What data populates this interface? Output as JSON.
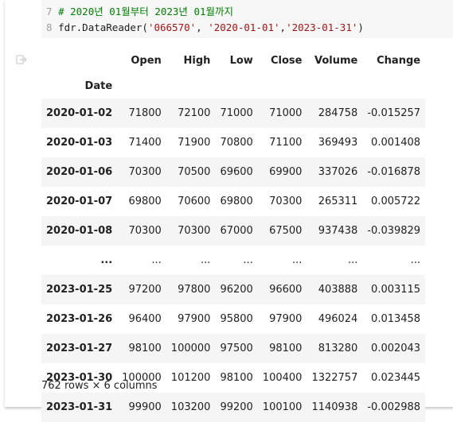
{
  "code": {
    "line7": {
      "number": "7",
      "text": "# 2020년 01월부터 2023년 01월까지"
    },
    "line8": {
      "number": "8",
      "prefix": "fdr.DataReader(",
      "arg1": "'066570'",
      "sep1": ", ",
      "arg2": "'2020-01-01'",
      "sep2": ",",
      "arg3": "'2023-01-31'",
      "suffix": ")"
    }
  },
  "output_icon": "output-redirect-icon",
  "dataframe": {
    "columns": [
      "Open",
      "High",
      "Low",
      "Close",
      "Volume",
      "Change"
    ],
    "index_name": "Date",
    "rows": [
      {
        "date": "2020-01-02",
        "open": "71800",
        "high": "72100",
        "low": "71000",
        "close": "71000",
        "volume": "284758",
        "change": "-0.015257"
      },
      {
        "date": "2020-01-03",
        "open": "71400",
        "high": "71900",
        "low": "70800",
        "close": "71100",
        "volume": "369493",
        "change": "0.001408"
      },
      {
        "date": "2020-01-06",
        "open": "70300",
        "high": "70500",
        "low": "69600",
        "close": "69900",
        "volume": "337026",
        "change": "-0.016878"
      },
      {
        "date": "2020-01-07",
        "open": "69800",
        "high": "70600",
        "low": "69800",
        "close": "70300",
        "volume": "265311",
        "change": "0.005722"
      },
      {
        "date": "2020-01-08",
        "open": "70300",
        "high": "70300",
        "low": "67000",
        "close": "67500",
        "volume": "937438",
        "change": "-0.039829"
      },
      {
        "date": "...",
        "open": "...",
        "high": "...",
        "low": "...",
        "close": "...",
        "volume": "...",
        "change": "..."
      },
      {
        "date": "2023-01-25",
        "open": "97200",
        "high": "97800",
        "low": "96200",
        "close": "96600",
        "volume": "403888",
        "change": "0.003115"
      },
      {
        "date": "2023-01-26",
        "open": "96400",
        "high": "97900",
        "low": "95800",
        "close": "97900",
        "volume": "496024",
        "change": "0.013458"
      },
      {
        "date": "2023-01-27",
        "open": "98100",
        "high": "100000",
        "low": "97500",
        "close": "98100",
        "volume": "813280",
        "change": "0.002043"
      },
      {
        "date": "2023-01-30",
        "open": "100000",
        "high": "101200",
        "low": "98100",
        "close": "100400",
        "volume": "1322757",
        "change": "0.023445"
      },
      {
        "date": "2023-01-31",
        "open": "99900",
        "high": "103200",
        "low": "99200",
        "close": "100100",
        "volume": "1140938",
        "change": "-0.002988"
      }
    ],
    "summary": "762 rows × 6 columns"
  }
}
